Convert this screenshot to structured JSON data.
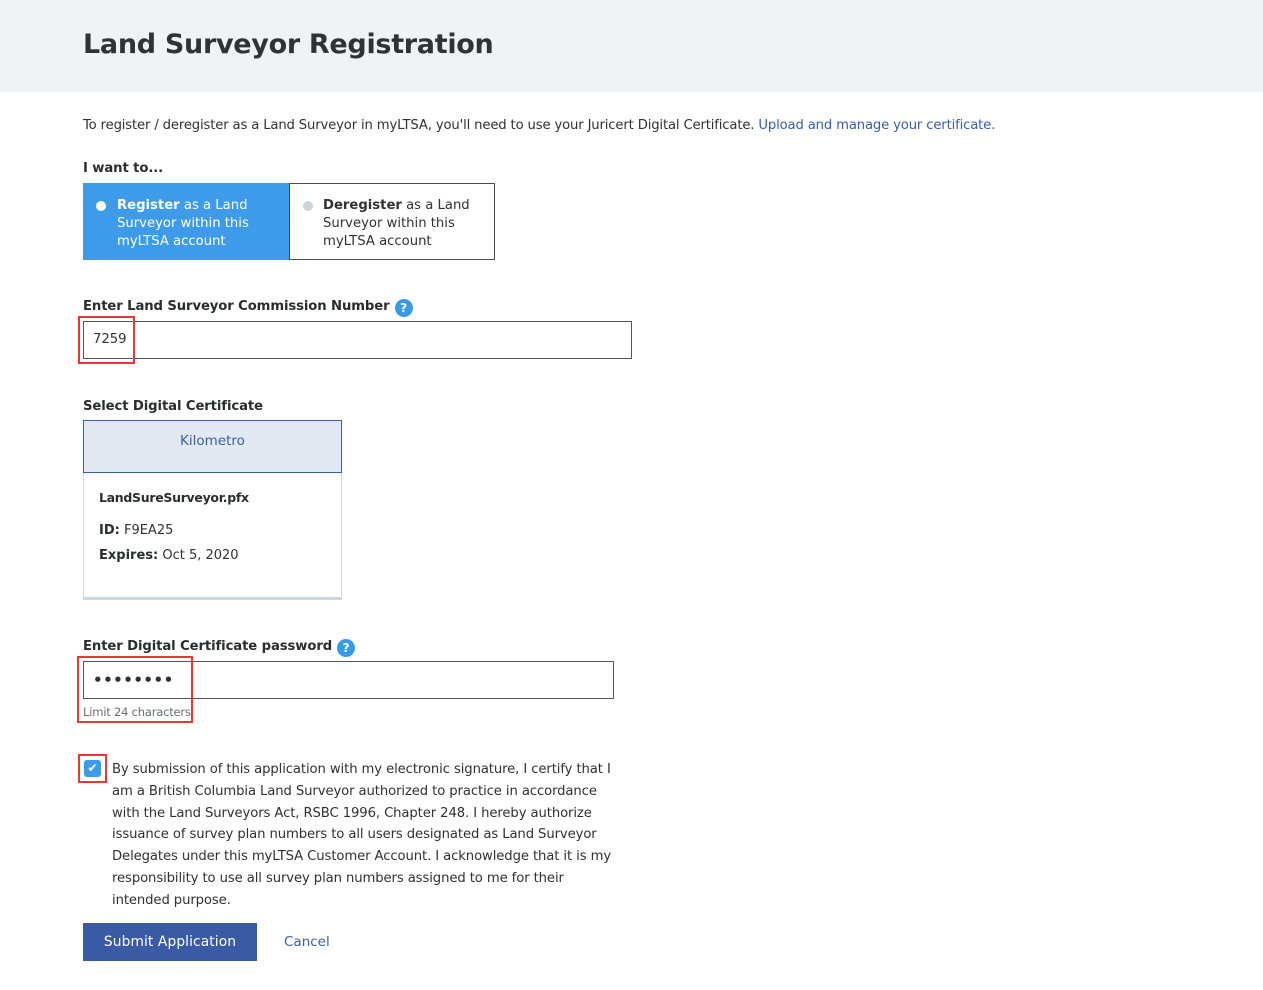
{
  "header": {
    "title": "Land Surveyor Registration"
  },
  "intro": {
    "text": "To register / deregister as a Land Surveyor in myLTSA, you'll need to use your Juricert Digital Certificate.",
    "link": "Upload and manage your certificate."
  },
  "action": {
    "label": "I want to...",
    "options": [
      {
        "bold": "Register",
        "rest": " as a Land Surveyor within this myLTSA account",
        "selected": true
      },
      {
        "bold": "Deregister",
        "rest": " as a Land Surveyor within this myLTSA account",
        "selected": false
      }
    ]
  },
  "commission": {
    "label": "Enter Land Surveyor Commission Number",
    "help_icon": "?",
    "value": "7259"
  },
  "certificate": {
    "label": "Select Digital Certificate",
    "name": "Kilometro",
    "file": "LandSureSurveyor.pfx",
    "id_label": "ID:",
    "id_value": " F9EA25",
    "expires_label": "Expires:",
    "expires_value": " Oct 5, 2020"
  },
  "password": {
    "label": "Enter Digital Certificate password",
    "help_icon": "?",
    "value": "••••••••",
    "hint": "Limit 24 characters"
  },
  "consent": {
    "checked": true,
    "check_glyph": "✔",
    "text": "By submission of this application with my electronic signature, I certify that I am a British Columbia Land Surveyor authorized to practice in accordance with the Land Surveyors Act, RSBC 1996, Chapter 248. I hereby authorize issuance of survey plan numbers to all users designated as Land Surveyor Delegates under this myLTSA Customer Account. I acknowledge that it is my responsibility to use all survey plan numbers assigned to me for their intended purpose."
  },
  "buttons": {
    "submit": "Submit Application",
    "cancel": "Cancel"
  },
  "colors": {
    "accent": "#3d9be9",
    "primary_button": "#3a5aa3",
    "link": "#3a5fa4",
    "highlight": "#e53935"
  }
}
